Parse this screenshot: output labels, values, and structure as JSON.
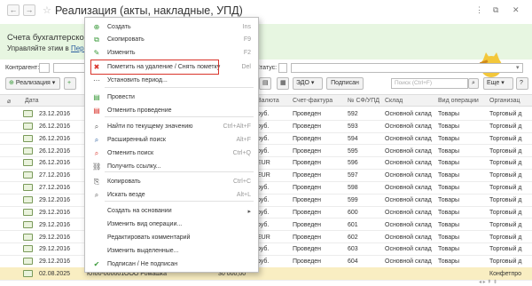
{
  "window": {
    "title": "Реализация (акты, накладные, УПД)",
    "nav_back": "←",
    "nav_forward": "→",
    "controls": [
      "⋮",
      "⧉",
      "✕"
    ]
  },
  "banner": {
    "line1": "Счета бухгалтерского",
    "line2_prefix": "Управляйте этим в",
    "line2_link": "Перс"
  },
  "filters": {
    "contractor_label": "Контрагент:",
    "status_label": "Статус:"
  },
  "toolbar": {
    "realization": "Реализация",
    "edo": "ЭДО",
    "sign": "Подписан",
    "search_placeholder": "Поиск (Ctrl+F)",
    "more": "Еще"
  },
  "columns": [
    "Дата",
    "Валюта",
    "Счет-фактура",
    "№ СФ/УПД",
    "Склад",
    "Вид операции",
    "Организац"
  ],
  "rows": [
    {
      "date": "23.12.2016",
      "currency": "руб.",
      "invoice": "Проведен",
      "num": "592",
      "warehouse": "Основной склад",
      "op": "Товары",
      "org": "Торговый д"
    },
    {
      "date": "26.12.2016",
      "currency": "руб.",
      "invoice": "Проведен",
      "num": "593",
      "warehouse": "Основной склад",
      "op": "Товары",
      "org": "Торговый д"
    },
    {
      "date": "26.12.2016",
      "currency": "руб.",
      "invoice": "Проведен",
      "num": "594",
      "warehouse": "Основной склад",
      "op": "Товары",
      "org": "Торговый д"
    },
    {
      "date": "26.12.2016",
      "currency": "руб.",
      "invoice": "Проведен",
      "num": "595",
      "warehouse": "Основной склад",
      "op": "Товары",
      "org": "Торговый д"
    },
    {
      "date": "26.12.2016",
      "currency": "EUR",
      "invoice": "Проведен",
      "num": "596",
      "warehouse": "Основной склад",
      "op": "Товары",
      "org": "Торговый д"
    },
    {
      "date": "27.12.2016",
      "currency": "EUR",
      "invoice": "Проведен",
      "num": "597",
      "warehouse": "Основной склад",
      "op": "Товары",
      "org": "Торговый д"
    },
    {
      "date": "27.12.2016",
      "currency": "руб.",
      "invoice": "Проведен",
      "num": "598",
      "warehouse": "Основной склад",
      "op": "Товары",
      "org": "Торговый д"
    },
    {
      "date": "29.12.2016",
      "currency": "руб.",
      "invoice": "Проведен",
      "num": "599",
      "warehouse": "Основной склад",
      "op": "Товары",
      "org": "Торговый д"
    },
    {
      "date": "29.12.2016",
      "currency": "руб.",
      "invoice": "Проведен",
      "num": "600",
      "warehouse": "Основной склад",
      "op": "Товары",
      "org": "Торговый д"
    },
    {
      "date": "29.12.2016",
      "currency": "руб.",
      "invoice": "Проведен",
      "num": "601",
      "warehouse": "Основной склад",
      "op": "Товары",
      "org": "Торговый д"
    },
    {
      "date": "29.12.2016",
      "currency": "EUR",
      "invoice": "Проведен",
      "num": "602",
      "warehouse": "Основной склад",
      "op": "Товары",
      "org": "Торговый д"
    },
    {
      "date": "29.12.2016",
      "currency": "руб.",
      "invoice": "Проведен",
      "num": "603",
      "warehouse": "Основной склад",
      "op": "Товары",
      "org": "Торговый д"
    },
    {
      "date": "29.12.2016",
      "currency": "руб.",
      "invoice": "Проведен",
      "num": "604",
      "warehouse": "Основной склад",
      "op": "Товары",
      "org": "Торговый д"
    }
  ],
  "selected_row": {
    "date": "02.08.2025",
    "num_prefix": "КЛ00-000001",
    "contractor": "ООО Ромашка",
    "sum": "30 000,00",
    "org": "Конфетпро"
  },
  "context_menu": [
    {
      "label": "Создать",
      "shortcut": "Ins",
      "icon": "plus-icon"
    },
    {
      "label": "Скопировать",
      "shortcut": "F9",
      "icon": "copy-icon"
    },
    {
      "label": "Изменить",
      "shortcut": "F2",
      "icon": "pencil-icon"
    },
    {
      "label": "Пометить на удаление / Снять пометку",
      "shortcut": "Del",
      "icon": "delete-mark-icon"
    },
    {
      "label": "Установить период...",
      "shortcut": "",
      "icon": "period-icon"
    },
    {
      "label": "Провести",
      "shortcut": "",
      "icon": "post-icon"
    },
    {
      "label": "Отменить проведение",
      "shortcut": "",
      "icon": "unpost-icon"
    },
    {
      "label": "Найти по текущему значению",
      "shortcut": "Ctrl+Alt+F",
      "icon": "find-icon"
    },
    {
      "label": "Расширенный поиск",
      "shortcut": "Alt+F",
      "icon": "adv-search-icon"
    },
    {
      "label": "Отменить поиск",
      "shortcut": "Ctrl+Q",
      "icon": "cancel-search-icon"
    },
    {
      "label": "Получить ссылку...",
      "shortcut": "",
      "icon": "link-icon"
    },
    {
      "label": "Копировать",
      "shortcut": "Ctrl+C",
      "icon": "clipboard-icon"
    },
    {
      "label": "Искать везде",
      "shortcut": "Alt+L",
      "icon": "search-everywhere-icon"
    },
    {
      "label": "Создать на основании",
      "shortcut": "",
      "icon": ""
    },
    {
      "label": "Изменить вид операции...",
      "shortcut": "",
      "icon": ""
    },
    {
      "label": "Редактировать комментарий",
      "shortcut": "",
      "icon": ""
    },
    {
      "label": "Изменить выделенные...",
      "shortcut": "",
      "icon": ""
    },
    {
      "label": "Подписан / Не подписан",
      "shortcut": "",
      "icon": "check-icon"
    }
  ],
  "colors": {
    "banner_bg": "#e7f6e1",
    "highlight_border": "#d9342b",
    "selected_row_bg": "#f9eec2"
  }
}
